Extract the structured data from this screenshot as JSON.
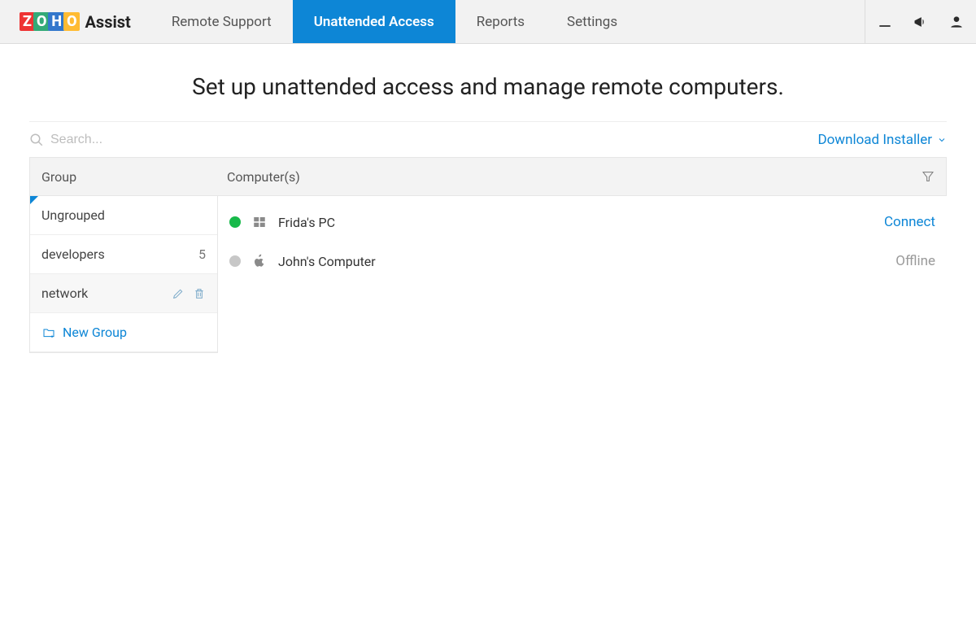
{
  "brand": {
    "zoho": "ZOHO",
    "product": "Assist"
  },
  "nav": {
    "remote_support": "Remote Support",
    "unattended": "Unattended Access",
    "reports": "Reports",
    "settings": "Settings"
  },
  "page": {
    "title": "Set up unattended access and manage remote computers."
  },
  "search": {
    "placeholder": "Search..."
  },
  "toolbar": {
    "download": "Download Installer"
  },
  "columns": {
    "group": "Group",
    "computers": "Computer(s)"
  },
  "groups": [
    {
      "name": "Ungrouped",
      "selected": true
    },
    {
      "name": "developers",
      "count": "5"
    },
    {
      "name": "network",
      "hover": true
    }
  ],
  "new_group_label": "New Group",
  "computers": [
    {
      "name": "Frida's PC",
      "status": "online",
      "os": "windows",
      "action": "Connect",
      "action_enabled": true
    },
    {
      "name": "John's Computer",
      "status": "offline",
      "os": "apple",
      "action": "Offline",
      "action_enabled": false
    }
  ]
}
